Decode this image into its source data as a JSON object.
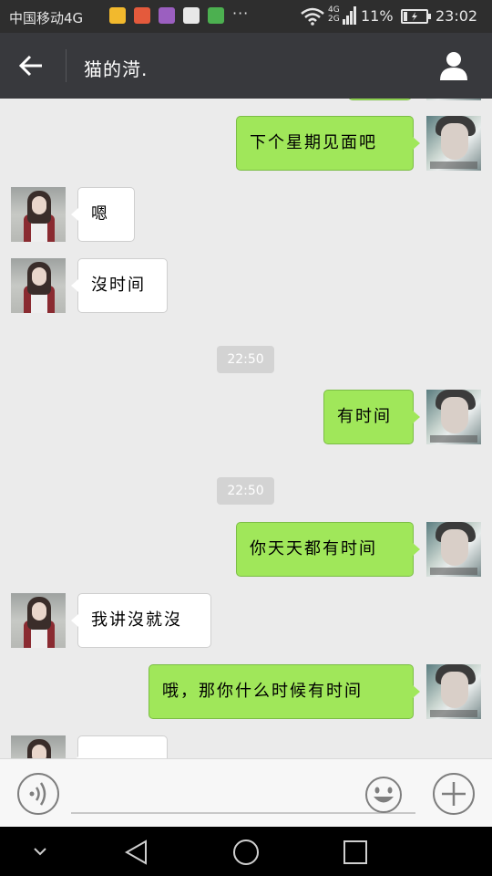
{
  "status_bar": {
    "carrier": "中国移动4G",
    "more": "···",
    "network_top": "4G",
    "network_bottom": "2G",
    "battery_percent": "11%",
    "time": "23:02",
    "notification_colors": [
      "#f2b92d",
      "#e45a3c",
      "#9b5fc0",
      "#3d3d3d",
      "#4cb050"
    ]
  },
  "header": {
    "title": "猫的渮."
  },
  "messages": [
    {
      "from": "me",
      "text": "下个星期见面吧"
    },
    {
      "from": "her",
      "text": "嗯"
    },
    {
      "from": "her",
      "text": "沒时间"
    },
    {
      "type": "timestamp",
      "text": "22:50"
    },
    {
      "from": "me",
      "text": "有时间"
    },
    {
      "type": "timestamp",
      "text": "22:50"
    },
    {
      "from": "me",
      "text": "你天天都有时间"
    },
    {
      "from": "her",
      "text": "我讲沒就沒"
    },
    {
      "from": "me",
      "text": "哦，那你什么时候有时间"
    },
    {
      "from": "her",
      "text": ""
    }
  ],
  "colors": {
    "my_bubble": "#a0e75a",
    "her_bubble": "#ffffff",
    "header_bg": "#38393d",
    "chat_bg": "#ebebeb"
  }
}
